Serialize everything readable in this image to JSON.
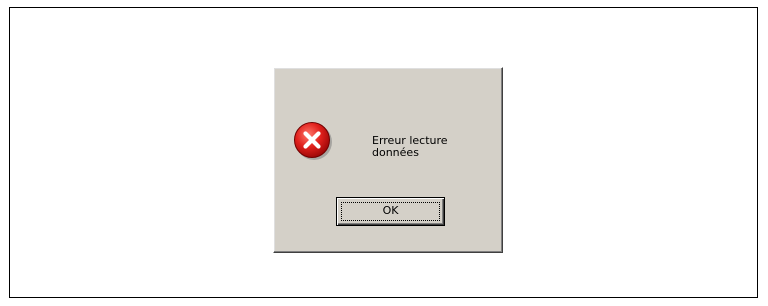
{
  "dialog": {
    "icon": "error-icon",
    "message_line1": "Erreur lecture",
    "message_line2": "données",
    "ok_label": "OK"
  },
  "colors": {
    "dialog_face": "#d4d0c8",
    "icon_red": "#e0201c",
    "background": "#ffffff"
  }
}
